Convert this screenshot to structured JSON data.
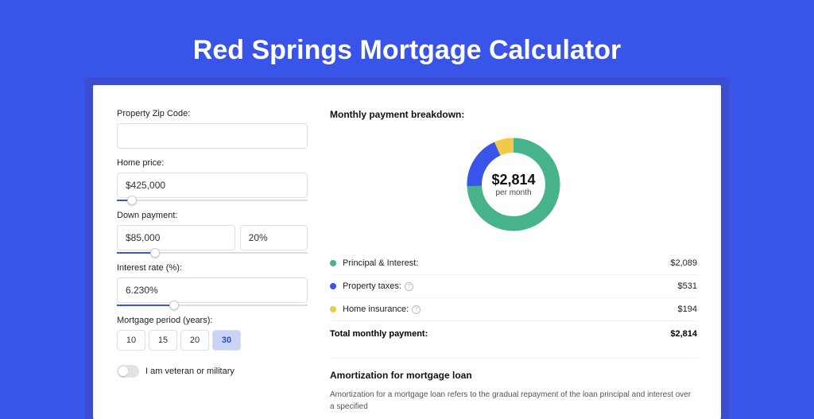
{
  "page_title": "Red Springs Mortgage Calculator",
  "left": {
    "zip": {
      "label": "Property Zip Code:",
      "value": ""
    },
    "home_price": {
      "label": "Home price:",
      "value": "$425,000",
      "slider_pct": 8
    },
    "down_payment": {
      "label": "Down payment:",
      "amount": "$85,000",
      "pct": "20%",
      "slider_pct": 20
    },
    "interest": {
      "label": "Interest rate (%):",
      "value": "6.230%",
      "slider_pct": 30
    },
    "period": {
      "label": "Mortgage period (years):",
      "options": [
        "10",
        "15",
        "20",
        "30"
      ],
      "selected": "30"
    },
    "veteran_label": "I am veteran or military"
  },
  "right": {
    "breakdown_title": "Monthly payment breakdown:",
    "donut": {
      "value": "$2,814",
      "sub": "per month"
    },
    "legend": [
      {
        "color": "#47b38a",
        "label": "Principal & Interest:",
        "info": false,
        "value": "$2,089"
      },
      {
        "color": "#3954e8",
        "label": "Property taxes:",
        "info": true,
        "value": "$531"
      },
      {
        "color": "#f3c948",
        "label": "Home insurance:",
        "info": true,
        "value": "$194"
      }
    ],
    "total": {
      "label": "Total monthly payment:",
      "value": "$2,814"
    },
    "amort": {
      "title": "Amortization for mortgage loan",
      "text": "Amortization for a mortgage loan refers to the gradual repayment of the loan principal and interest over a specified"
    }
  },
  "chart_data": {
    "type": "pie",
    "title": "Monthly payment breakdown",
    "categories": [
      "Principal & Interest",
      "Property taxes",
      "Home insurance"
    ],
    "values": [
      2089,
      531,
      194
    ],
    "colors": [
      "#47b38a",
      "#3954e8",
      "#f3c948"
    ],
    "total": 2814
  }
}
